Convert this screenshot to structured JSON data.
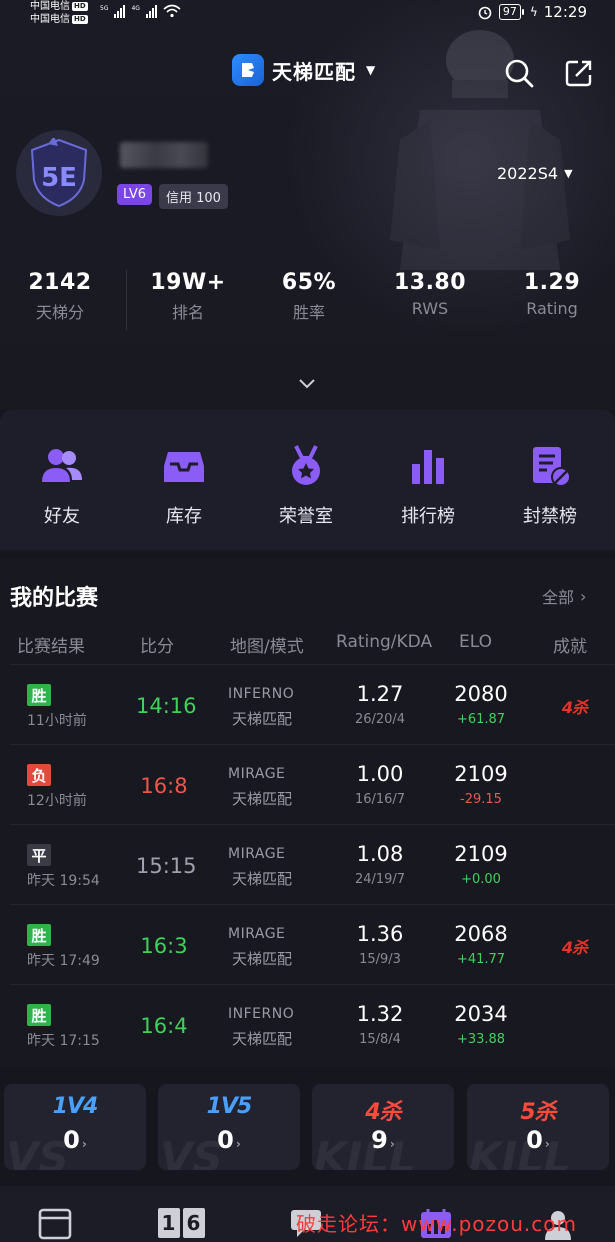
{
  "status_bar": {
    "carrier1": "中国电信",
    "carrier2": "中国电信",
    "hd": "HD",
    "net1": "5G",
    "net2": "4G",
    "battery": "97",
    "time": "12:29"
  },
  "header": {
    "title": "天梯匹配",
    "season": "2022S4"
  },
  "profile": {
    "level_badge": "LV6",
    "credit_badge": "信用 100",
    "logo_text": "5E"
  },
  "stats": [
    {
      "value": "2142",
      "label": "天梯分"
    },
    {
      "value": "19W+",
      "label": "排名"
    },
    {
      "value": "65%",
      "label": "胜率"
    },
    {
      "value": "13.80",
      "label": "RWS"
    },
    {
      "value": "1.29",
      "label": "Rating"
    }
  ],
  "quick_nav": [
    {
      "label": "好友",
      "icon": "friends-icon"
    },
    {
      "label": "库存",
      "icon": "inventory-icon"
    },
    {
      "label": "荣誉室",
      "icon": "medal-icon"
    },
    {
      "label": "排行榜",
      "icon": "leaderboard-icon"
    },
    {
      "label": "封禁榜",
      "icon": "ban-list-icon"
    }
  ],
  "matches": {
    "title": "我的比赛",
    "all_label": "全部",
    "columns": [
      "比赛结果",
      "比分",
      "地图/模式",
      "Rating/KDA",
      "ELO",
      "成就"
    ],
    "rows": [
      {
        "result": "胜",
        "result_type": "win",
        "time": "11小时前",
        "score": "14:16",
        "map": "INFERNO",
        "mode": "天梯匹配",
        "rating": "1.27",
        "kda": "26/20/4",
        "elo": "2080",
        "delta": "+61.87",
        "delta_type": "pos",
        "achievement": "4杀"
      },
      {
        "result": "负",
        "result_type": "loss",
        "time": "12小时前",
        "score": "16:8",
        "map": "MIRAGE",
        "mode": "天梯匹配",
        "rating": "1.00",
        "kda": "16/16/7",
        "elo": "2109",
        "delta": "-29.15",
        "delta_type": "neg",
        "achievement": ""
      },
      {
        "result": "平",
        "result_type": "draw",
        "time": "昨天 19:54",
        "score": "15:15",
        "map": "MIRAGE",
        "mode": "天梯匹配",
        "rating": "1.08",
        "kda": "24/19/7",
        "elo": "2109",
        "delta": "+0.00",
        "delta_type": "pos",
        "achievement": ""
      },
      {
        "result": "胜",
        "result_type": "win",
        "time": "昨天 17:49",
        "score": "16:3",
        "map": "MIRAGE",
        "mode": "天梯匹配",
        "rating": "1.36",
        "kda": "15/9/3",
        "elo": "2068",
        "delta": "+41.77",
        "delta_type": "pos",
        "achievement": "4杀"
      },
      {
        "result": "胜",
        "result_type": "win",
        "time": "昨天 17:15",
        "score": "16:4",
        "map": "INFERNO",
        "mode": "天梯匹配",
        "rating": "1.32",
        "kda": "15/8/4",
        "elo": "2034",
        "delta": "+33.88",
        "delta_type": "pos",
        "achievement": ""
      }
    ]
  },
  "highlights": [
    {
      "label": "1V4",
      "value": "0",
      "bg": "VS",
      "color": "blue"
    },
    {
      "label": "1V5",
      "value": "0",
      "bg": "VS",
      "color": "blue"
    },
    {
      "label": "4杀",
      "value": "9",
      "bg": "KILL",
      "color": "red"
    },
    {
      "label": "5杀",
      "value": "0",
      "bg": "KILL",
      "color": "red"
    }
  ],
  "bottom_nav": {
    "scoreboard_digits": [
      "1",
      "6"
    ],
    "watermark": "破走论坛：www.pozou.com"
  },
  "colors": {
    "accent_purple": "#7b46e6",
    "win": "#3dd35a",
    "loss": "#f0564a",
    "brand_blue": "#2d8cff"
  }
}
